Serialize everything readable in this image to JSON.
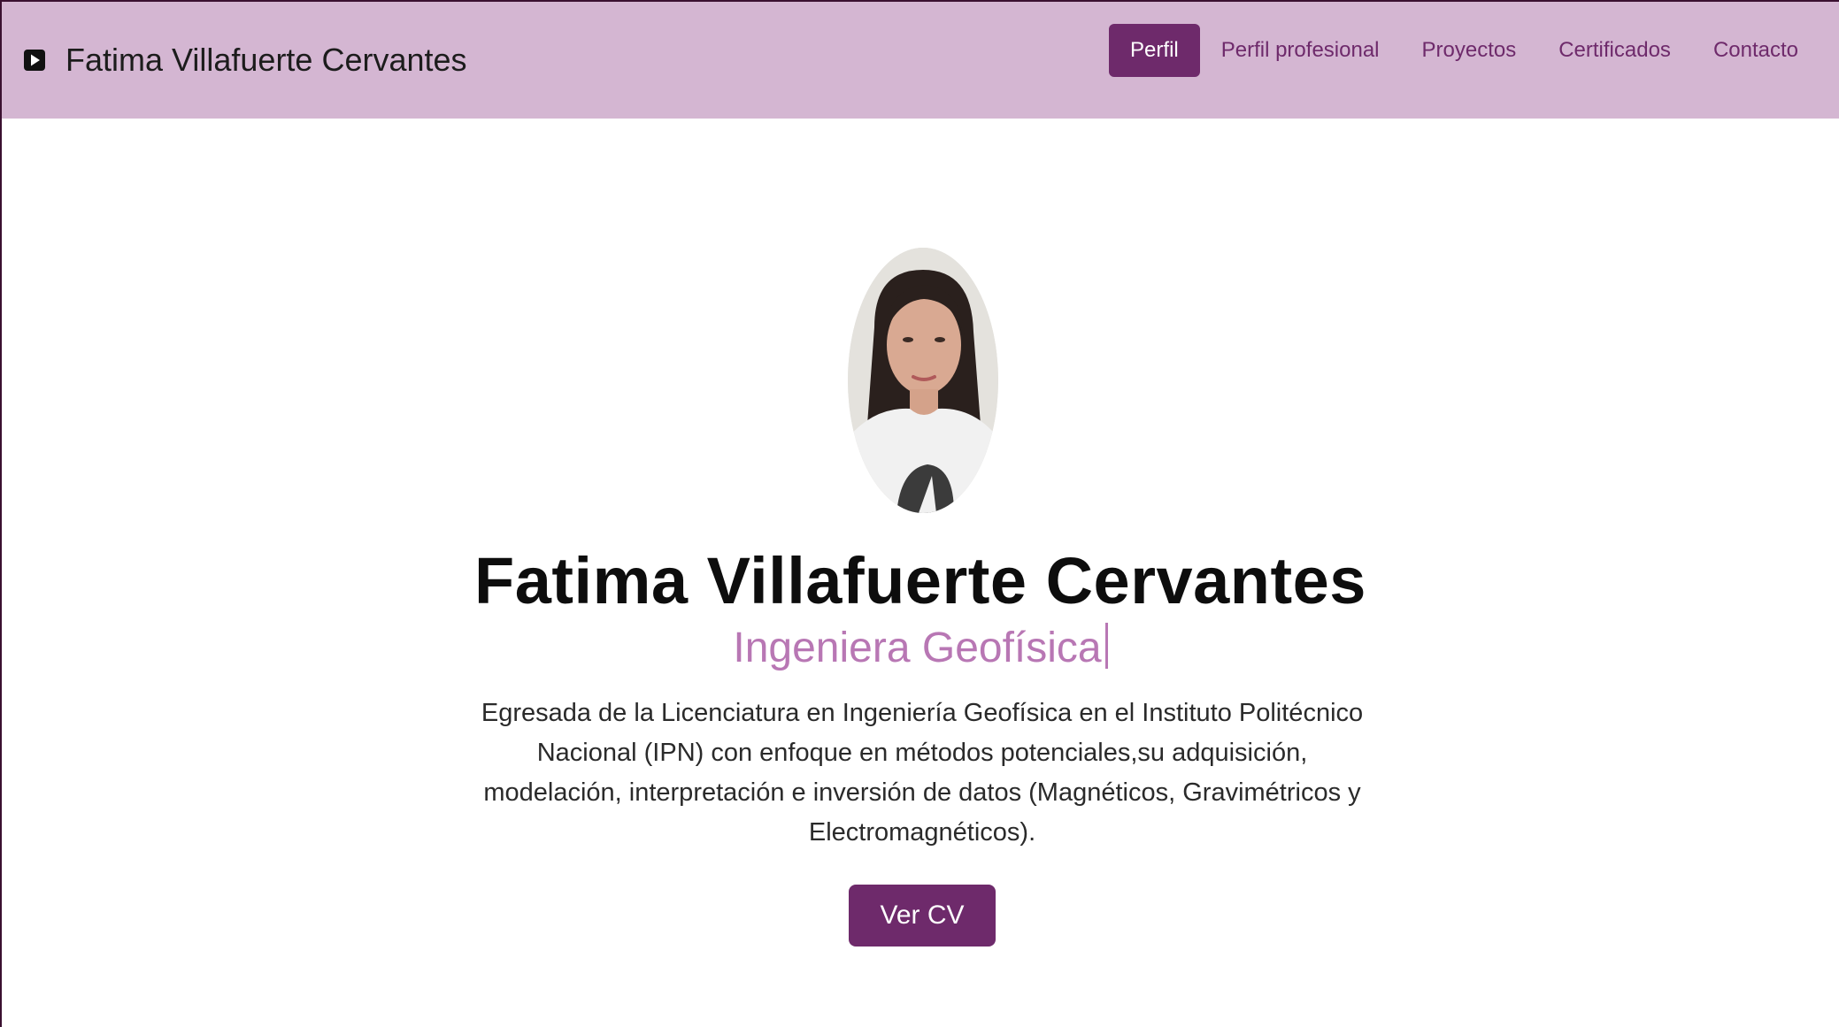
{
  "navbar": {
    "brand_icon": "play-square-icon",
    "brand_title": "Fatima Villafuerte Cervantes",
    "links": [
      {
        "label": "Perfil",
        "active": true
      },
      {
        "label": "Perfil profesional",
        "active": false
      },
      {
        "label": "Proyectos",
        "active": false
      },
      {
        "label": "Certificados",
        "active": false
      },
      {
        "label": "Contacto",
        "active": false
      }
    ]
  },
  "hero": {
    "name": "Fatima Villafuerte Cervantes",
    "role": "Ingeniera Geofísica",
    "description": "Egresada de la Licenciatura en Ingeniería Geofísica en el Instituto Politécnico Nacional (IPN) con enfoque en métodos potenciales,su adquisición, modelación, interpretación e inversión de datos (Magnéticos, Gravimétricos y Electromagnéticos).",
    "cv_button": "Ver CV"
  },
  "colors": {
    "navbar_bg": "#d4b6d2",
    "accent": "#6e2a6b",
    "role_text": "#b877b4"
  }
}
